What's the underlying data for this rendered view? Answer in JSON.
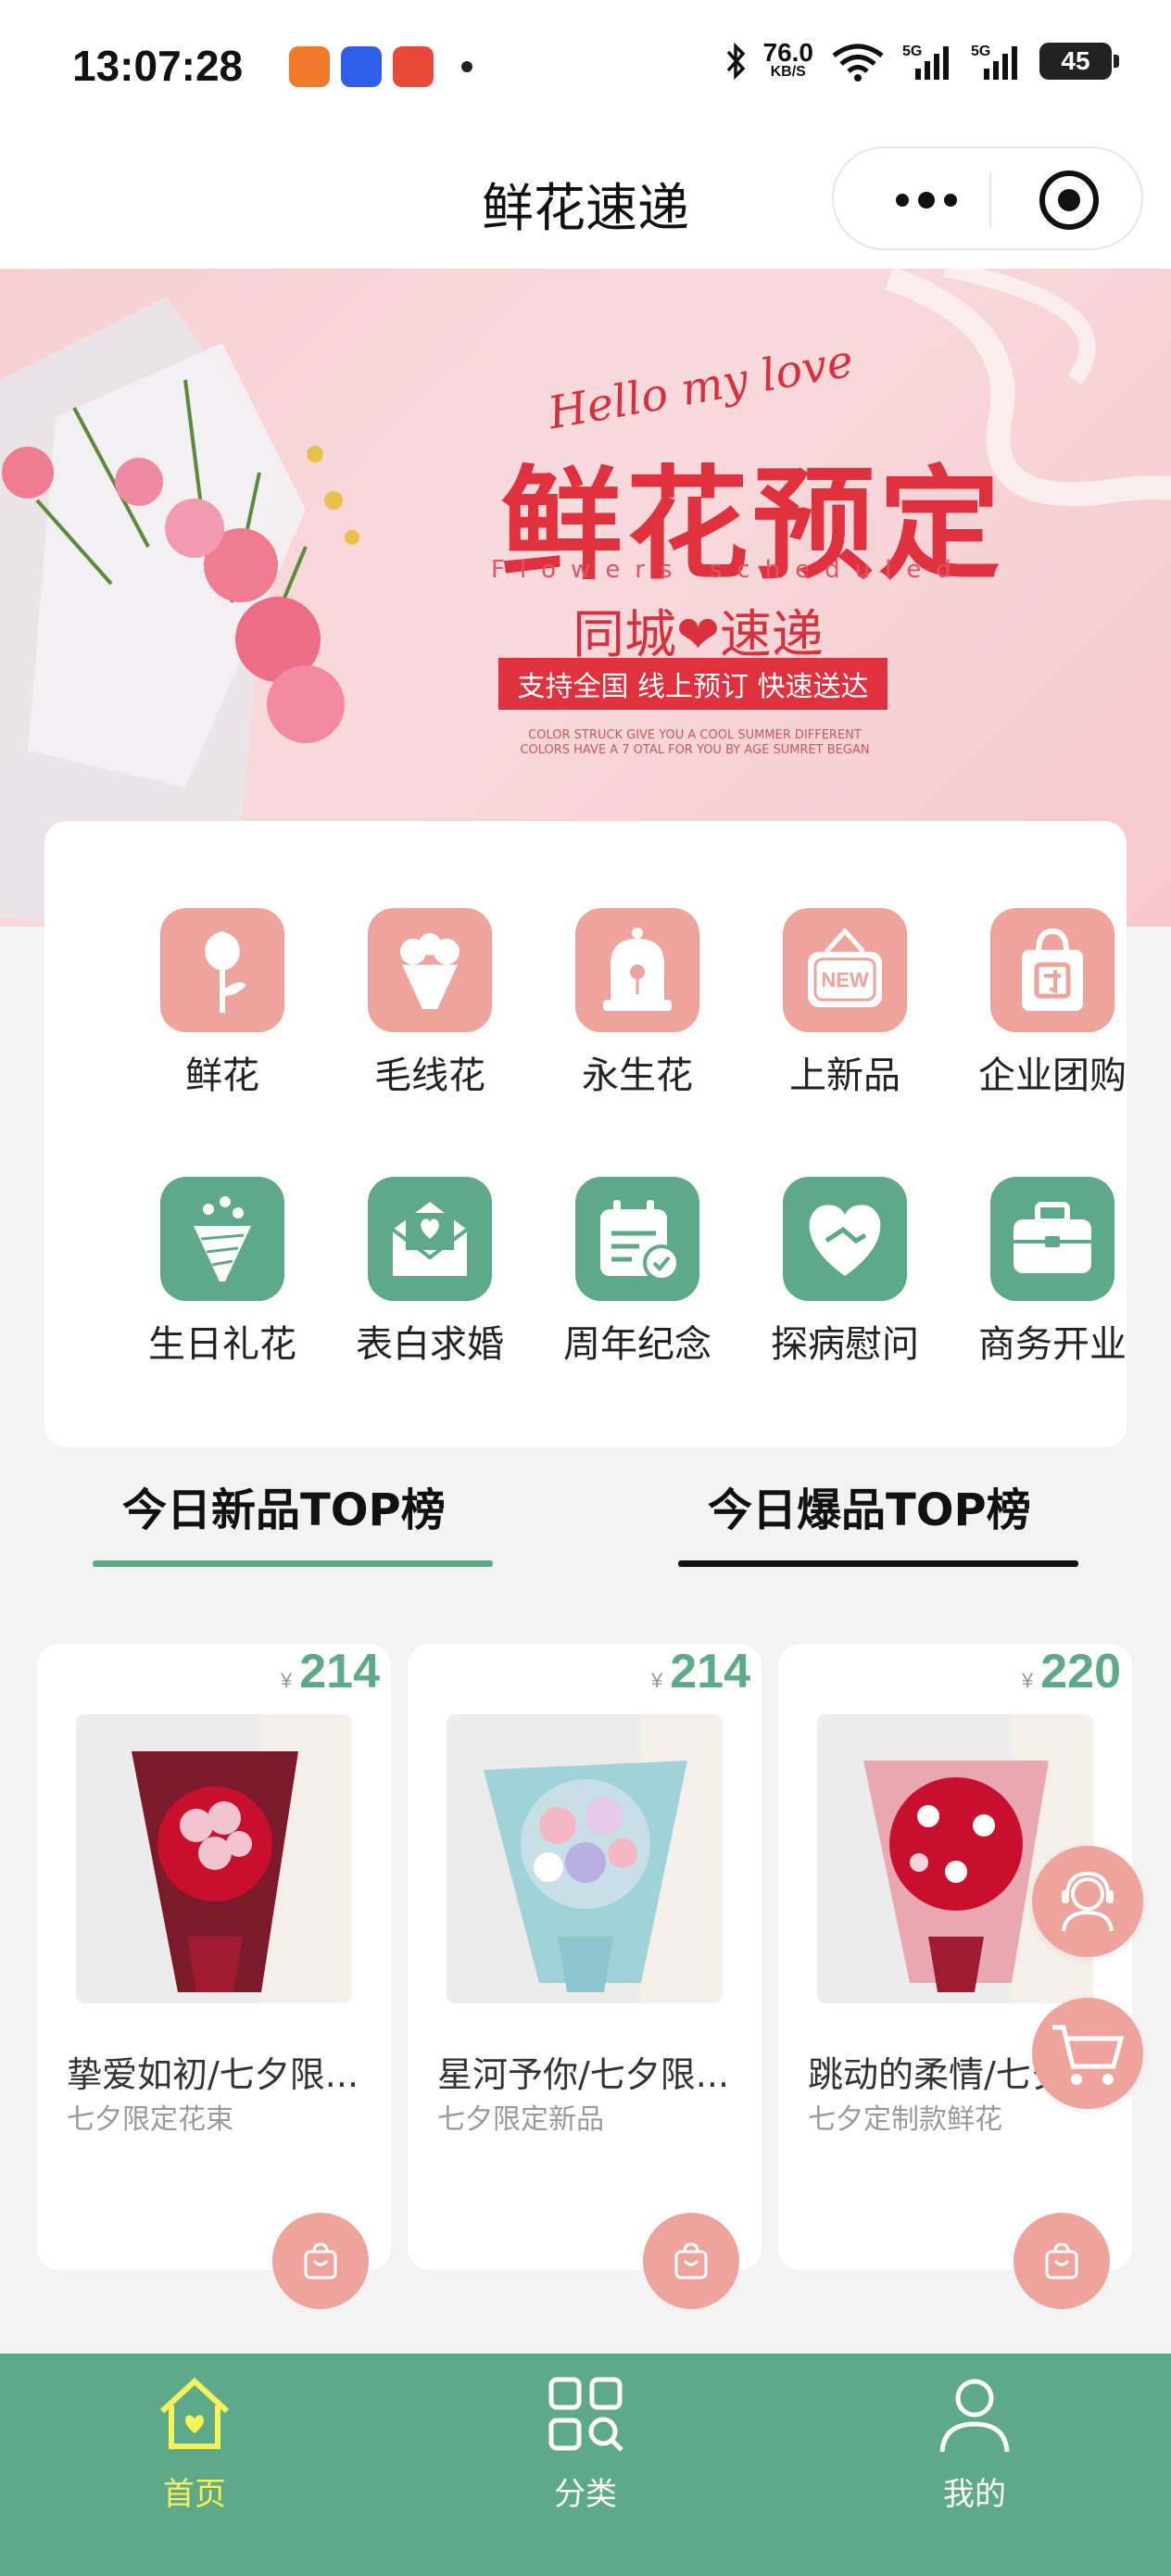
{
  "status_bar": {
    "time": "13:07:28",
    "net_speed": "76.0",
    "net_unit": "KB/S",
    "battery": "45",
    "icons": [
      "app-notification-icon",
      "app-notification-icon",
      "app-notification-icon",
      "bluetooth-icon",
      "wifi-icon",
      "signal-5g-icon",
      "signal-5g-icon",
      "battery-icon"
    ]
  },
  "header": {
    "title": "鲜花速递"
  },
  "banner": {
    "hello": "Hello my love",
    "headline": "鲜花预定",
    "english": "Flowers scheduled",
    "subtitle": "同城❤速递",
    "tagline": "支持全国  线上预订  快速送达",
    "small_text": "COLOR STRUCK GIVE YOU A COOL SUMMER DIFFERENT COLORS HAVE A 7 OTAL FOR YOU BY AGE SUMRET BEGAN"
  },
  "categories": [
    {
      "label": "鲜花",
      "icon": "rose-icon",
      "color": "#eea49c"
    },
    {
      "label": "毛线花",
      "icon": "bouquet-icon",
      "color": "#eea49c"
    },
    {
      "label": "永生花",
      "icon": "glass-dome-icon",
      "color": "#eea49c"
    },
    {
      "label": "上新品",
      "icon": "new-sign-icon",
      "color": "#eea49c"
    },
    {
      "label": "企业团购",
      "icon": "group-buy-bag-icon",
      "color": "#eea49c"
    },
    {
      "label": "生日礼花",
      "icon": "flower-cone-icon",
      "color": "#5fa98b"
    },
    {
      "label": "表白求婚",
      "icon": "love-letter-icon",
      "color": "#5fa98b"
    },
    {
      "label": "周年纪念",
      "icon": "calendar-check-icon",
      "color": "#5fa98b"
    },
    {
      "label": "探病慰问",
      "icon": "heart-handshake-icon",
      "color": "#5fa98b"
    },
    {
      "label": "商务开业",
      "icon": "briefcase-icon",
      "color": "#5fa98b"
    }
  ],
  "tabs": [
    {
      "label": "今日新品TOP榜",
      "active": true,
      "underline_color": "#5fa98b"
    },
    {
      "label": "今日爆品TOP榜",
      "active": false,
      "underline_color": "#111111"
    }
  ],
  "products": [
    {
      "currency": "¥",
      "price": "214",
      "name": "挚爱如初/七夕限...",
      "subtitle": "七夕限定花束"
    },
    {
      "currency": "¥",
      "price": "214",
      "name": "星河予你/七夕限...",
      "subtitle": "七夕限定新品"
    },
    {
      "currency": "¥",
      "price": "220",
      "name": "跳动的柔情/七夕",
      "subtitle": "七夕定制款鲜花"
    }
  ],
  "bottom_nav": [
    {
      "label": "首页",
      "icon": "home-icon",
      "active": true
    },
    {
      "label": "分类",
      "icon": "category-search-icon",
      "active": false
    },
    {
      "label": "我的",
      "icon": "user-icon",
      "active": false
    }
  ],
  "colors": {
    "accent_green": "#5fa98b",
    "accent_pink": "#eea49c",
    "nav_active": "#f5f25a",
    "banner_red": "#e0313f"
  }
}
